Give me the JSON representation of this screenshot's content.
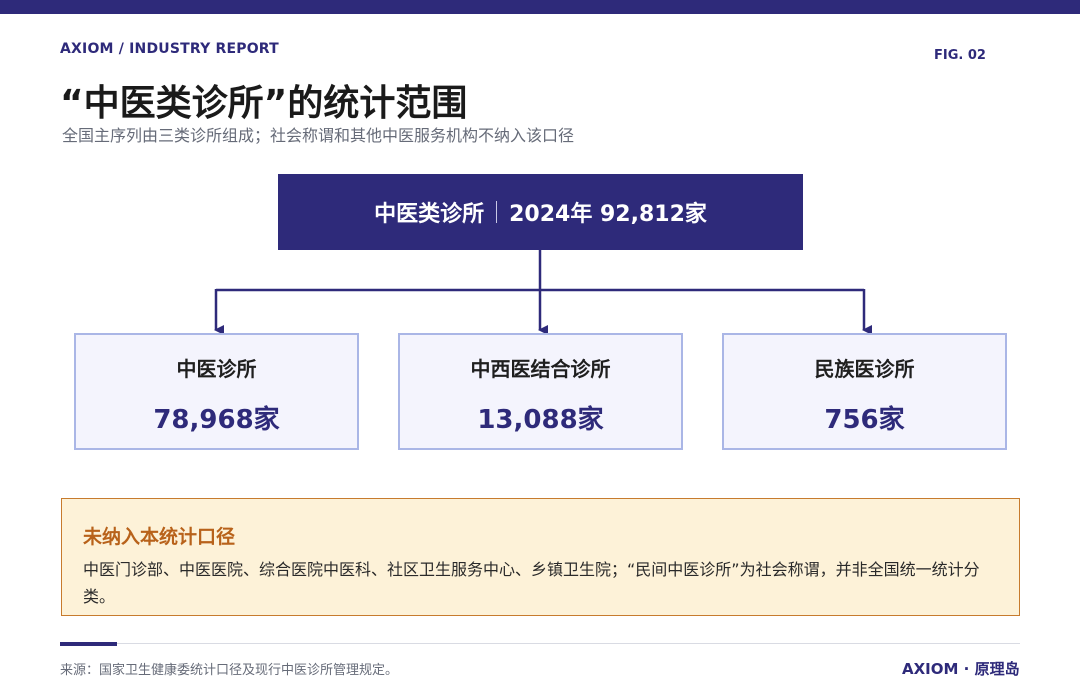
{
  "header": {
    "brand": "AXIOM / INDUSTRY REPORT",
    "fig_label": "FIG. 02",
    "title": "“中医类诊所”的统计范围",
    "subtitle": "全国主序列由三类诊所组成；社会称谓和其他中医服务机构不纳入该口径"
  },
  "diagram": {
    "root": {
      "name": "中医类诊所",
      "value": "2024年 92,812家"
    },
    "children": [
      {
        "name": "中医诊所",
        "value": "78,968家"
      },
      {
        "name": "中西医结合诊所",
        "value": "13,088家"
      },
      {
        "name": "民族医诊所",
        "value": "756家"
      }
    ]
  },
  "note": {
    "title": "未纳入本统计口径",
    "text": "中医门诊部、中医医院、综合医院中医科、社区卫生服务中心、乡镇卫生院；“民间中医诊所”为社会称谓，并非全国统一统计分类。"
  },
  "footer": {
    "source": "来源：国家卫生健康委统计口径及现行中医诊所管理规定。",
    "brand": "AXIOM · 原理岛"
  },
  "colors": {
    "brand": "#2e2a7a",
    "child_border": "#aab6e6",
    "child_fill": "#f4f4fd",
    "note_fill": "#fdf2d8",
    "note_border": "#c77b2d",
    "note_title": "#b8621a"
  }
}
